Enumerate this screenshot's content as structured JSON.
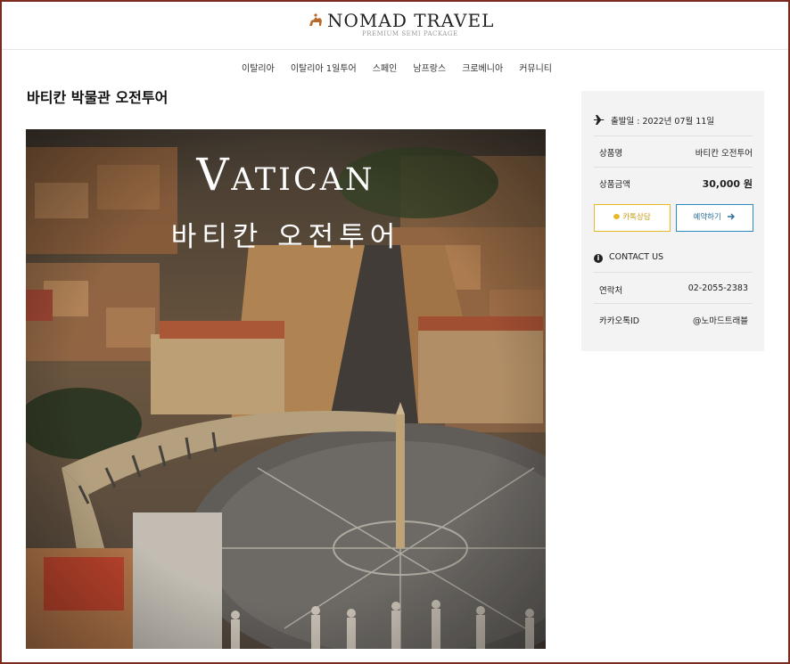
{
  "brand": {
    "name": "NOMAD TRAVEL",
    "tagline": "PREMIUM SEMI PACKAGE"
  },
  "nav": {
    "items": [
      "이탈리아",
      "이탈리아 1일투어",
      "스페인",
      "남프랑스",
      "크로베니아",
      "커뮤니티"
    ]
  },
  "page": {
    "title": "바티칸 박물관 오전투어"
  },
  "hero": {
    "title": "Vatican",
    "subtitle": "바티칸 오전투어"
  },
  "panel": {
    "departure": "출발일 : 2022년 07월 11일",
    "product_label": "상품명",
    "product_value": "바티칸 오전투어",
    "price_label": "상품금액",
    "price_value": "30,000 원",
    "kakao_button": "카톡상담",
    "reserve_button": "예약하기",
    "contact_title": "CONTACT US",
    "phone_label": "연락처",
    "phone_value": "02-2055-2383",
    "kakao_label": "카카오톡ID",
    "kakao_value": "@노마드트래블"
  },
  "colors": {
    "frame": "#7b2a20",
    "kakao": "#e6b92a",
    "reserve": "#2a8ac0",
    "panel_bg": "#f3f3f3"
  },
  "icons": {
    "logo": "traveler-camel-icon",
    "departure": "airplane-icon",
    "kakao": "chat-bubble-icon",
    "reserve": "arrow-right-icon",
    "contact": "info-icon"
  }
}
